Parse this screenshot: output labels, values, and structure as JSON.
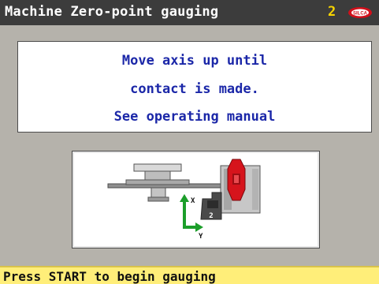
{
  "header": {
    "title": "Machine Zero-point gauging",
    "page_number": "2",
    "logo_icon": "silca-logo-icon",
    "logo_text": "SILCA"
  },
  "message": {
    "lines": [
      "Move axis up until",
      "contact is made.",
      "See operating manual"
    ]
  },
  "diagram": {
    "axis_x_label": "X",
    "axis_y_label": "Y",
    "clamp_number": "2",
    "arrow_up_color": "#1c9e2a",
    "arrow_right_color": "#1c9e2a",
    "clamp_color": "#d6141c"
  },
  "status": {
    "text": "Press START to begin gauging"
  },
  "colors": {
    "title_bg": "#3c3c3c",
    "accent_yellow": "#f7d400",
    "message_text": "#1b27a8",
    "status_bg": "#ffee79",
    "background": "#b5b2ab"
  }
}
